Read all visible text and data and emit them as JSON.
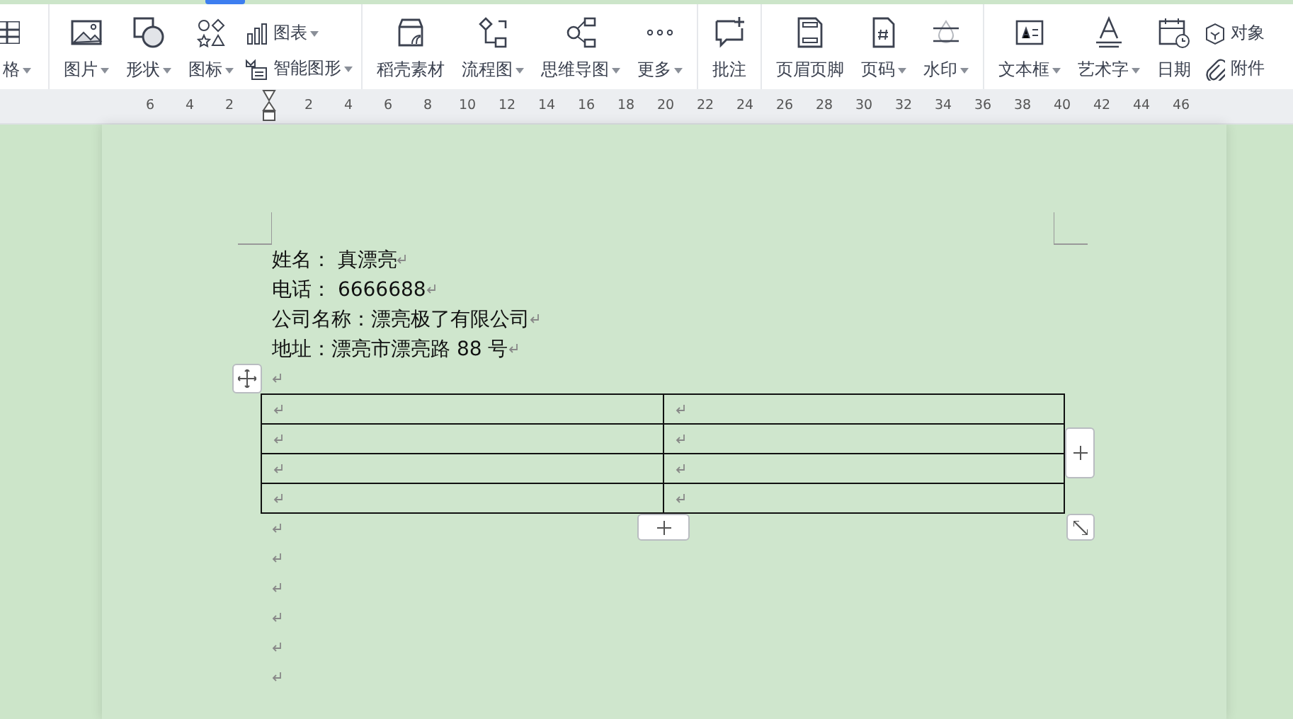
{
  "toolbar": {
    "groups": [
      {
        "items": [
          {
            "kind": "large",
            "label": "格",
            "dropdown": true
          }
        ]
      },
      {
        "items": [
          {
            "kind": "large",
            "label": "图片",
            "dropdown": true
          },
          {
            "kind": "large",
            "label": "形状",
            "dropdown": true
          },
          {
            "kind": "large",
            "label": "图标",
            "dropdown": true
          },
          {
            "kind": "stack",
            "items": [
              {
                "label": "图表",
                "dropdown": true
              },
              {
                "label": "智能图形",
                "dropdown": true
              }
            ]
          }
        ]
      },
      {
        "items": [
          {
            "kind": "large",
            "label": "稻壳素材",
            "dropdown": false
          },
          {
            "kind": "large",
            "label": "流程图",
            "dropdown": true
          },
          {
            "kind": "large",
            "label": "思维导图",
            "dropdown": true
          },
          {
            "kind": "large",
            "label": "更多",
            "dropdown": true
          }
        ]
      },
      {
        "items": [
          {
            "kind": "large",
            "label": "批注",
            "dropdown": false
          }
        ]
      },
      {
        "items": [
          {
            "kind": "large",
            "label": "页眉页脚",
            "dropdown": false
          },
          {
            "kind": "large",
            "label": "页码",
            "dropdown": true
          },
          {
            "kind": "large",
            "label": "水印",
            "dropdown": true
          }
        ]
      },
      {
        "items": [
          {
            "kind": "large",
            "label": "文本框",
            "dropdown": true
          },
          {
            "kind": "large",
            "label": "艺术字",
            "dropdown": true
          },
          {
            "kind": "large",
            "label": "日期",
            "dropdown": false
          },
          {
            "kind": "stack",
            "items": [
              {
                "label": "对象",
                "dropdown": false
              },
              {
                "label": "附件",
                "dropdown": false
              }
            ]
          }
        ]
      }
    ]
  },
  "ruler": {
    "left_labels": [
      "6",
      "4",
      "2"
    ],
    "right_labels": [
      "2",
      "4",
      "6",
      "8",
      "10",
      "12",
      "14",
      "16",
      "18",
      "20",
      "22",
      "24",
      "26",
      "28",
      "30",
      "32",
      "34",
      "36",
      "38",
      "40",
      "42",
      "44",
      "46"
    ]
  },
  "document": {
    "body": [
      {
        "kind": "text",
        "text": "姓名： 真漂亮"
      },
      {
        "kind": "text",
        "text": "电话： 6666688"
      },
      {
        "kind": "text",
        "text": "公司名称：漂亮极了有限公司"
      },
      {
        "kind": "text",
        "text": "地址：漂亮市漂亮路 88 号"
      },
      {
        "kind": "empty"
      },
      {
        "kind": "table",
        "rows": [
          {
            "cells": [
              {
                "kind": "empty"
              },
              {
                "kind": "empty"
              }
            ]
          },
          {
            "cells": [
              {
                "kind": "empty"
              },
              {
                "kind": "empty"
              }
            ]
          },
          {
            "cells": [
              {
                "kind": "empty"
              },
              {
                "kind": "empty"
              }
            ]
          },
          {
            "cells": [
              {
                "kind": "empty"
              },
              {
                "kind": "empty"
              }
            ]
          }
        ]
      },
      {
        "kind": "empty"
      },
      {
        "kind": "empty"
      },
      {
        "kind": "empty"
      },
      {
        "kind": "empty"
      },
      {
        "kind": "empty"
      },
      {
        "kind": "empty"
      }
    ]
  }
}
